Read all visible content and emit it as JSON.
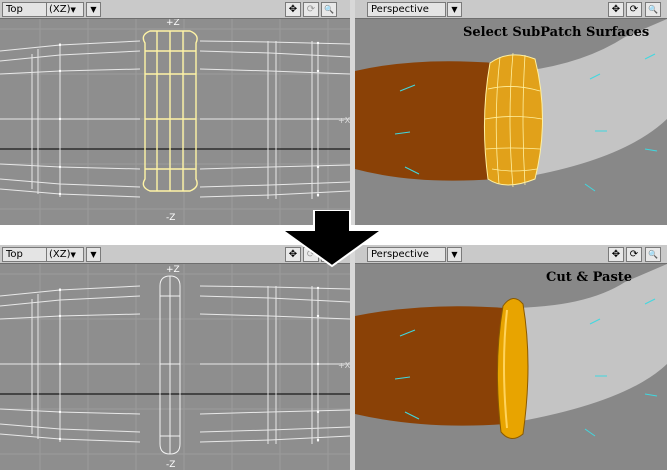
{
  "top_panel": {
    "left_viewport": {
      "view_name": "Top",
      "axis_label": "(XZ)",
      "dropdown_glyph": "▼",
      "axis_pos": "+Z",
      "axis_neg": "-Z",
      "side_axis": "+X"
    },
    "right_viewport": {
      "view_name": "Perspective",
      "dropdown_glyph": "▼",
      "caption": "Select SubPatch Surfaces"
    },
    "controls": {
      "move": "✥",
      "rotate": "⟳",
      "zoom": "🔍",
      "maximize": "▢"
    }
  },
  "bottom_panel": {
    "left_viewport": {
      "view_name": "Top",
      "axis_label": "(XZ)",
      "dropdown_glyph": "▼",
      "axis_pos": "+Z",
      "axis_neg": "-Z",
      "side_axis": "+X"
    },
    "right_viewport": {
      "view_name": "Perspective",
      "dropdown_glyph": "▼",
      "caption": "Cut & Paste"
    },
    "controls": {
      "move": "✥",
      "rotate": "⟳",
      "zoom": "🔍",
      "maximize": "▢"
    }
  },
  "colors": {
    "viewport_bg": "#8e8e8e",
    "grid": "#9a9a9a",
    "wire": "#e6e6e6",
    "selected_wire": "#fff7a8",
    "brown_mesh": "#8a4106",
    "grey_mesh": "#c4c4c4",
    "gold_ring": "#e8a400",
    "normals": "#40d8e0"
  },
  "icons": [
    "move-icon",
    "rotate-icon",
    "zoom-icon",
    "maximize-icon",
    "down-arrow-icon"
  ]
}
